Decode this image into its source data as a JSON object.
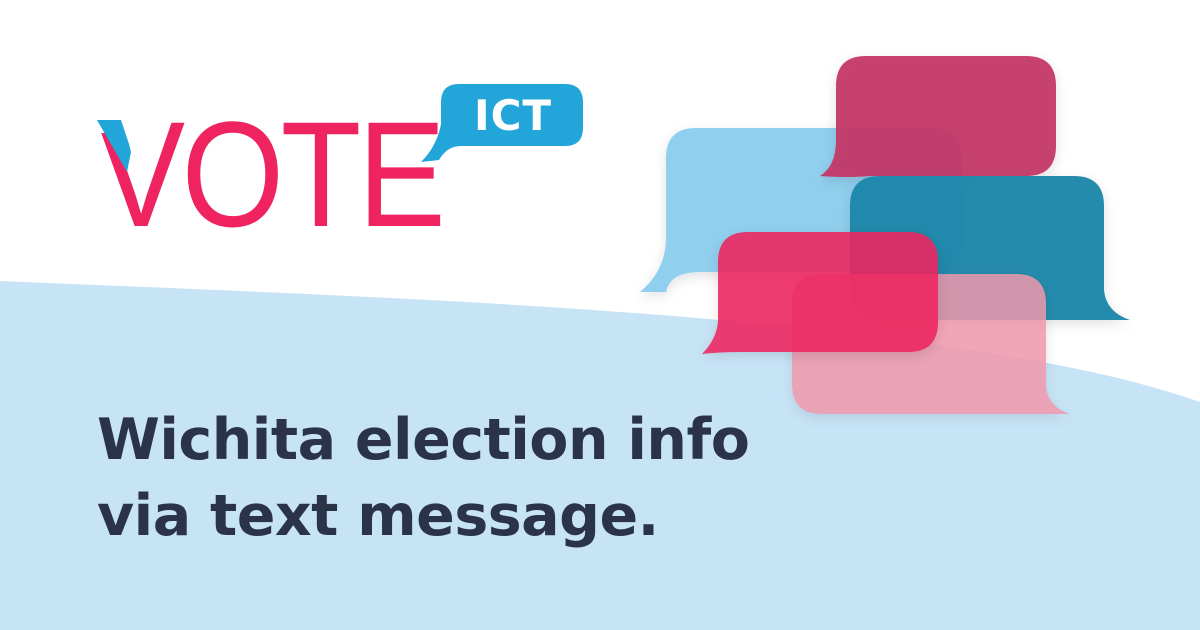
{
  "logo": {
    "word": "VOTE",
    "badge": "ICT",
    "colors": {
      "word": "#ee2360",
      "tick": "#22a6d9",
      "badge": "#22a6d9"
    }
  },
  "headline": {
    "line1": "Wichita election info",
    "line2": "via text message."
  },
  "colors": {
    "background": "#ffffff",
    "wave": "#c7e4f7",
    "text": "#2b3348",
    "bubble_light_blue": "#8ccdee",
    "bubble_magenta": "#c33566",
    "bubble_teal": "#1f86a9",
    "bubble_pink": "#ee2360",
    "bubble_light_pink": "#f197ad"
  },
  "icons": [
    "speech-bubble-icon"
  ]
}
